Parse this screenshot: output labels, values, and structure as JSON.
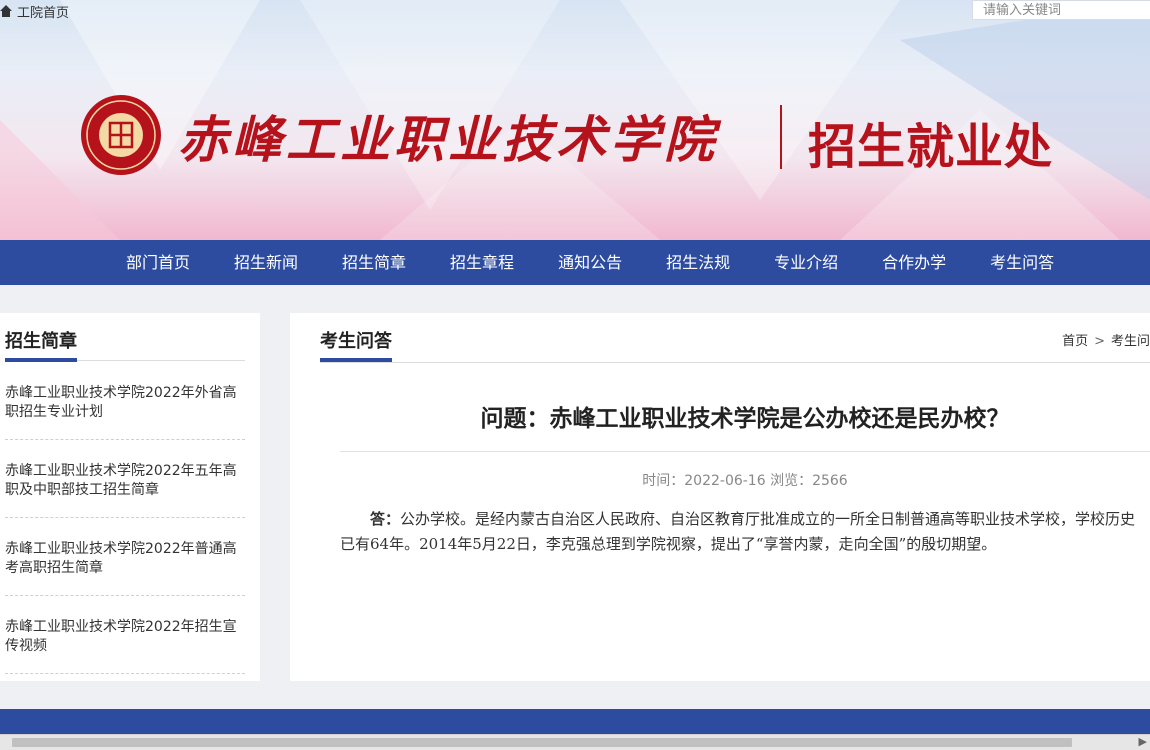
{
  "topbar": {
    "home_label": "工院首页",
    "search_placeholder": "请输入关键词"
  },
  "banner": {
    "school_name": "赤峰工业职业技术学院",
    "dept_title": "招生就业处",
    "seal_char": "工",
    "brand_color": "#b5121b"
  },
  "nav": {
    "items": [
      "部门首页",
      "招生新闻",
      "招生简章",
      "招生章程",
      "通知公告",
      "招生法规",
      "专业介绍",
      "合作办学",
      "考生问答"
    ],
    "color": "#2d4ca0"
  },
  "sidebar": {
    "title": "招生简章",
    "items": [
      "赤峰工业职业技术学院2022年外省高职招生专业计划",
      "赤峰工业职业技术学院2022年五年高职及中职部技工招生简章",
      "赤峰工业职业技术学院2022年普通高考高职招生简章",
      "赤峰工业职业技术学院2022年招生宣传视频"
    ]
  },
  "main": {
    "title": "考生问答",
    "breadcrumb": [
      "首页",
      "考生问"
    ],
    "question": "问题：赤峰工业职业技术学院是公办校还是民办校？",
    "meta": "时间：2022-06-16 浏览：2566",
    "answer_label": "答：",
    "answer_text": "公办学校。是经内蒙古自治区人民政府、自治区教育厅批准成立的一所全日制普通高等职业技术学校，学校历史已有64年。2014年5月22日，李克强总理到学院视察，提出了“享誉内蒙，走向全国”的殷切期望。"
  }
}
